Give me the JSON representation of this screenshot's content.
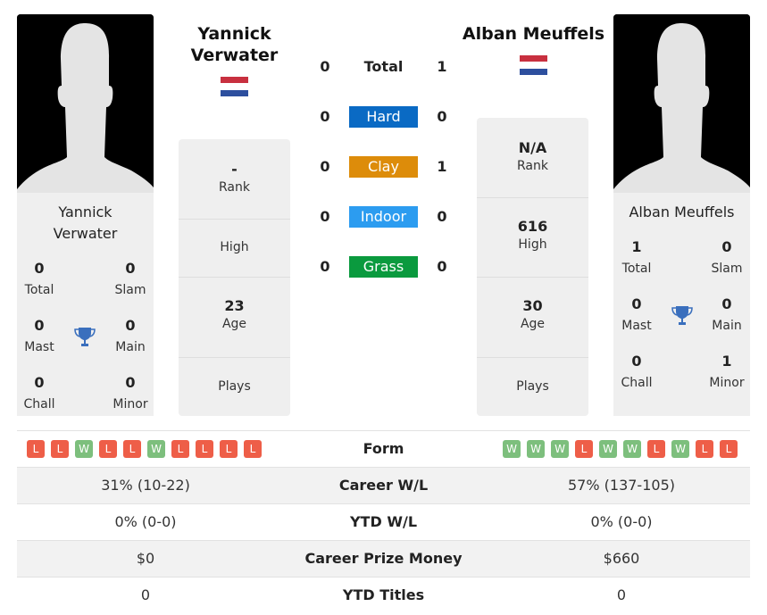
{
  "colors": {
    "hard": "#0a6ac4",
    "clay": "#dd8c0a",
    "indoor": "#2c9cf0",
    "grass": "#0a9a3e",
    "win": "#7dbf7d",
    "loss": "#ee5e48",
    "trophy": "#3a6fbd",
    "flag_red": "#c8303f",
    "flag_white": "#ffffff",
    "flag_blue": "#2d4f9e"
  },
  "player1": {
    "name": "Yannick Verwater",
    "header_name_line1": "Yannick",
    "header_name_line2": "Verwater",
    "card_name_line1": "Yannick",
    "card_name_line2": "Verwater",
    "flag": "netherlands-flag",
    "titles": {
      "total": {
        "value": "0",
        "label": "Total"
      },
      "slam": {
        "value": "0",
        "label": "Slam"
      },
      "mast": {
        "value": "0",
        "label": "Mast"
      },
      "main": {
        "value": "0",
        "label": "Main"
      },
      "chall": {
        "value": "0",
        "label": "Chall"
      },
      "minor": {
        "value": "0",
        "label": "Minor"
      }
    },
    "info": {
      "rank": {
        "value": "-",
        "label": "Rank"
      },
      "high": {
        "value": "",
        "label": "High"
      },
      "age": {
        "value": "23",
        "label": "Age"
      },
      "plays": {
        "value": "",
        "label": "Plays"
      }
    },
    "form": [
      "L",
      "L",
      "W",
      "L",
      "L",
      "W",
      "L",
      "L",
      "L",
      "L"
    ],
    "career_wl": "31% (10-22)",
    "ytd_wl": "0% (0-0)",
    "career_prize": "$0",
    "ytd_titles": "0"
  },
  "player2": {
    "name": "Alban Meuffels",
    "header_name": "Alban Meuffels",
    "card_name": "Alban Meuffels",
    "flag": "netherlands-flag",
    "titles": {
      "total": {
        "value": "1",
        "label": "Total"
      },
      "slam": {
        "value": "0",
        "label": "Slam"
      },
      "mast": {
        "value": "0",
        "label": "Mast"
      },
      "main": {
        "value": "0",
        "label": "Main"
      },
      "chall": {
        "value": "0",
        "label": "Chall"
      },
      "minor": {
        "value": "1",
        "label": "Minor"
      }
    },
    "info": {
      "rank": {
        "value": "N/A",
        "label": "Rank"
      },
      "high": {
        "value": "616",
        "label": "High"
      },
      "age": {
        "value": "30",
        "label": "Age"
      },
      "plays": {
        "value": "",
        "label": "Plays"
      }
    },
    "form": [
      "W",
      "W",
      "W",
      "L",
      "W",
      "W",
      "L",
      "W",
      "L",
      "L"
    ],
    "career_wl": "57% (137-105)",
    "ytd_wl": "0% (0-0)",
    "career_prize": "$660",
    "ytd_titles": "0"
  },
  "h2h": [
    {
      "label": "Total",
      "p1": "0",
      "p2": "1",
      "style": "plain"
    },
    {
      "label": "Hard",
      "p1": "0",
      "p2": "0",
      "style": "hard"
    },
    {
      "label": "Clay",
      "p1": "0",
      "p2": "1",
      "style": "clay"
    },
    {
      "label": "Indoor",
      "p1": "0",
      "p2": "0",
      "style": "indoor"
    },
    {
      "label": "Grass",
      "p1": "0",
      "p2": "0",
      "style": "grass"
    }
  ],
  "table": {
    "form_label": "Form",
    "career_wl_label": "Career W/L",
    "ytd_wl_label": "YTD W/L",
    "career_prize_label": "Career Prize Money",
    "ytd_titles_label": "YTD Titles"
  }
}
